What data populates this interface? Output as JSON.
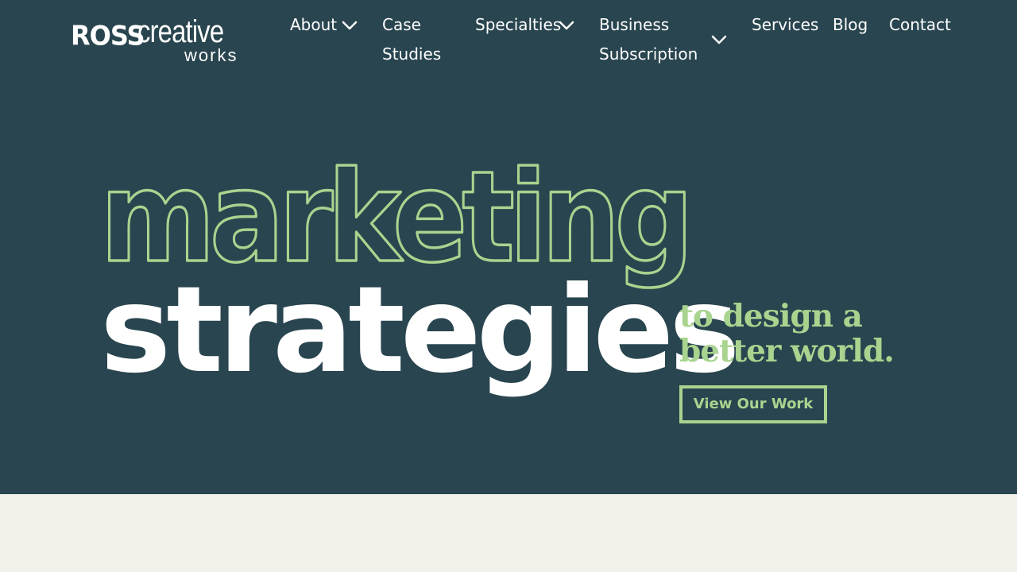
{
  "brand": {
    "logo_word1": "ROSS",
    "logo_word2": "creative",
    "logo_word3": "works"
  },
  "nav": {
    "about": "About",
    "case_studies_line1": "Case",
    "case_studies_line2": "Studies",
    "specialties": "Specialties",
    "business_sub_line1": "Business",
    "business_sub_line2": "Subscription",
    "services": "Services",
    "blog": "Blog",
    "contact": "Contact"
  },
  "hero": {
    "headline_outline": "marketing",
    "headline_solid": "strategies",
    "tagline_line1": "to design a",
    "tagline_line2": "better world.",
    "cta_label": "View Our Work"
  },
  "colors": {
    "hero_bg": "#29454f",
    "accent_green": "#a8d48f",
    "text_white": "#ffffff",
    "page_bg": "#f1f0e9"
  },
  "icons": {
    "dropdown": "chevron-down-icon"
  }
}
